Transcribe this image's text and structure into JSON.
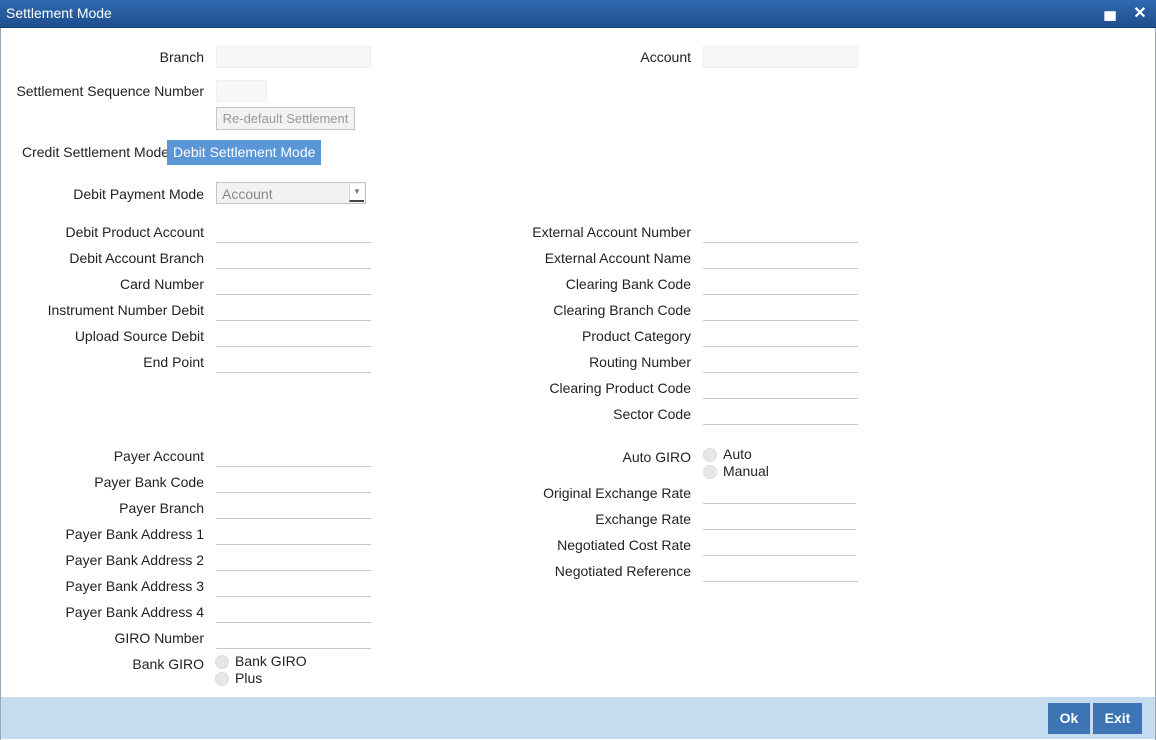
{
  "window": {
    "title": "Settlement Mode",
    "minimize_icon": "minimize-icon",
    "close_icon": "close-icon"
  },
  "header": {
    "branch_label": "Branch",
    "account_label": "Account",
    "seq_label": "Settlement Sequence Number",
    "redefault_button": "Re-default Settlement"
  },
  "tabs": {
    "credit": "Credit Settlement Mode",
    "debit": "Debit Settlement Mode",
    "active": "debit"
  },
  "debit": {
    "payment_mode_label": "Debit Payment Mode",
    "payment_mode_value": "Account",
    "left_fields": [
      "Debit Product Account",
      "Debit Account Branch",
      "Card Number",
      "Instrument Number Debit",
      "Upload Source Debit",
      "End Point"
    ],
    "right_fields": [
      "External Account Number",
      "External Account Name",
      "Clearing Bank Code",
      "Clearing Branch Code",
      "Product Category",
      "Routing Number",
      "Clearing Product Code",
      "Sector Code"
    ]
  },
  "payer": {
    "fields": [
      "Payer Account",
      "Payer Bank Code",
      "Payer Branch",
      "Payer Bank Address 1",
      "Payer Bank Address 2",
      "Payer Bank Address 3",
      "Payer Bank Address 4",
      "GIRO Number"
    ],
    "bank_giro_label": "Bank GIRO",
    "bank_giro_options": [
      "Bank GIRO",
      "Plus"
    ]
  },
  "giro": {
    "auto_giro_label": "Auto GIRO",
    "auto_giro_options": [
      "Auto",
      "Manual"
    ],
    "rate_fields": [
      "Original Exchange Rate",
      "Exchange Rate",
      "Negotiated Cost Rate",
      "Negotiated Reference"
    ]
  },
  "footer": {
    "ok": "Ok",
    "exit": "Exit"
  },
  "colors": {
    "titlebar": "#2a5f9e",
    "active_tab": "#5b96d6",
    "footer": "#c5dcf0",
    "footer_button": "#3d74b3"
  }
}
